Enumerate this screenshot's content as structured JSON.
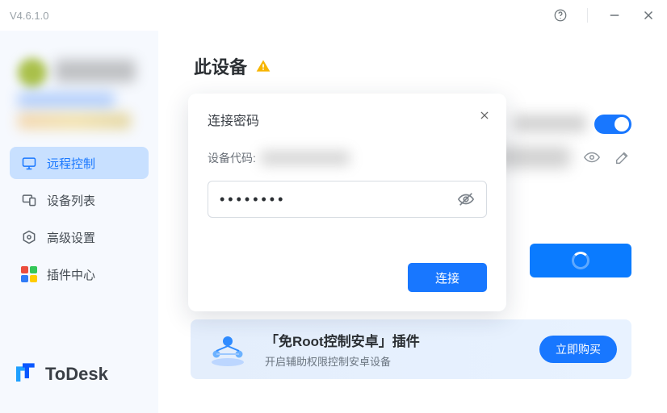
{
  "titlebar": {
    "version": "V4.6.1.0"
  },
  "sidebar": {
    "items": [
      {
        "label": "远程控制",
        "name": "sidebar-item-remote-control",
        "active": true
      },
      {
        "label": "设备列表",
        "name": "sidebar-item-device-list",
        "active": false
      },
      {
        "label": "高级设置",
        "name": "sidebar-item-advanced-settings",
        "active": false
      },
      {
        "label": "插件中心",
        "name": "sidebar-item-plugin-center",
        "active": false
      }
    ],
    "brand": "ToDesk"
  },
  "content": {
    "section_title": "此设备"
  },
  "promo": {
    "title": "「免Root控制安卓」插件",
    "subtitle": "开启辅助权限控制安卓设备",
    "cta": "立即购买"
  },
  "modal": {
    "title": "连接密码",
    "device_code_label": "设备代码:",
    "password_masked": "••••••••",
    "connect_label": "连接"
  },
  "colors": {
    "primary": "#1877ff",
    "sidebar_bg": "#f6f9fe",
    "nav_active_bg": "#c8e0ff"
  }
}
